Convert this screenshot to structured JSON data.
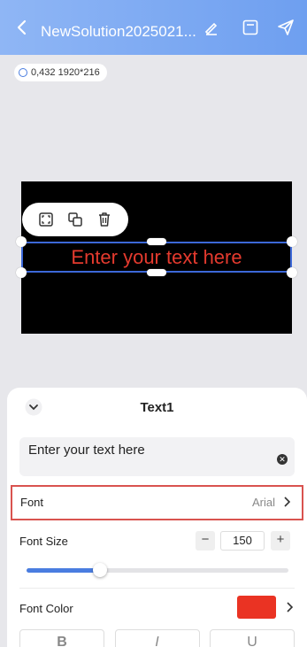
{
  "header": {
    "title": "NewSolution2025021...",
    "icons": [
      "back-arrow-icon",
      "edit-icon",
      "save-icon",
      "send-icon"
    ],
    "gradient_start": "#8fb6f5",
    "gradient_end": "#6e9ff0"
  },
  "badge": {
    "text": "0,432 1920*216"
  },
  "canvas": {
    "text": "Enter your text here",
    "text_color": "#e43a2e",
    "toolbar_icons": [
      "fit-screen-icon",
      "copy-icon",
      "delete-icon"
    ]
  },
  "panel": {
    "title": "Text1",
    "text_value": "Enter your text here",
    "font": {
      "label": "Font",
      "value": "Arial"
    },
    "font_size": {
      "label": "Font Size",
      "minus": "−",
      "value": "150",
      "plus": "+",
      "slider_fraction": 0.28
    },
    "font_color": {
      "label": "Font Color",
      "color": "#ea3323"
    },
    "style_buttons": [
      "B",
      "I",
      "U"
    ]
  }
}
